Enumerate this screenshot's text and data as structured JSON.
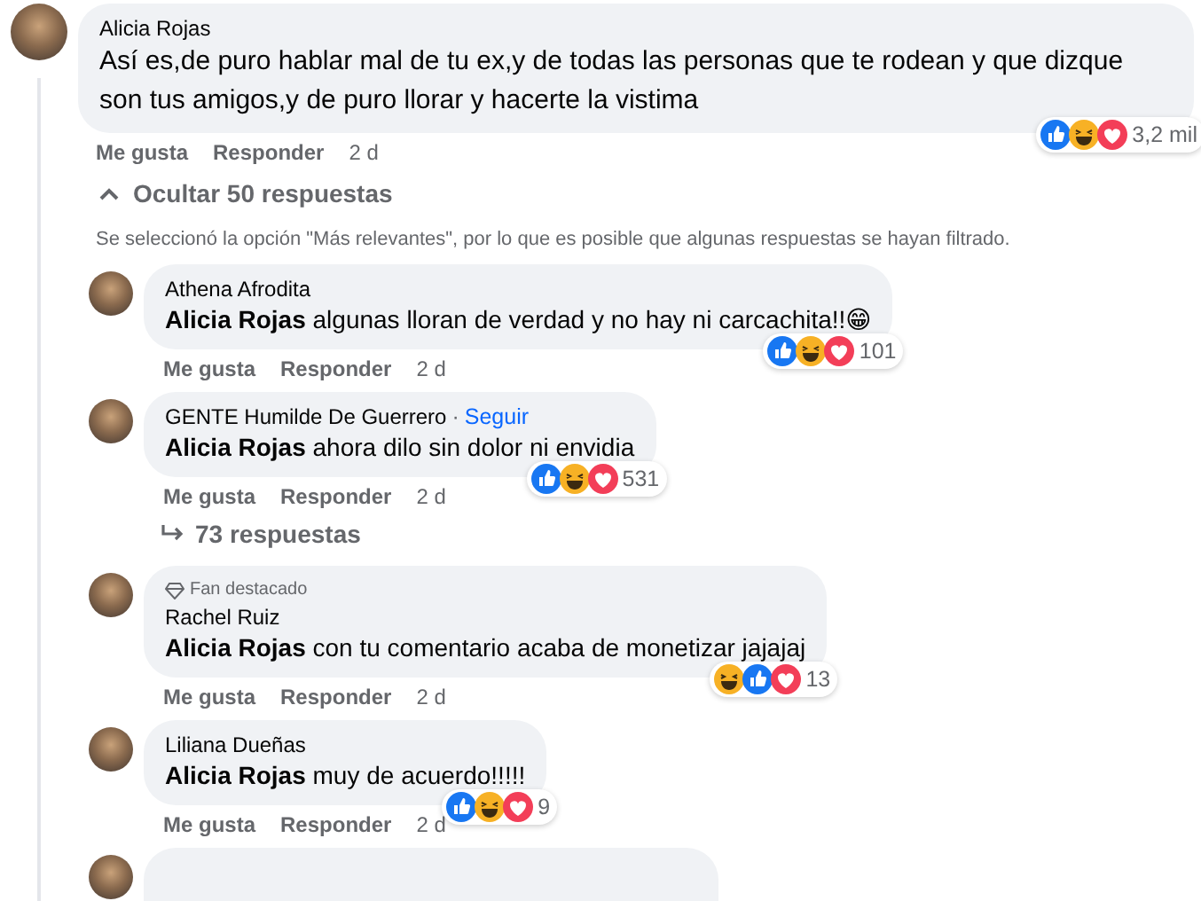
{
  "comment": {
    "author": "Alicia Rojas",
    "text": "Así es,de puro hablar mal de tu ex,y de todas las personas que te rodean y que dizque son tus amigos,y de puro llorar y hacerte la vistima",
    "reactions": [
      {
        "kind": "like"
      },
      {
        "kind": "haha"
      },
      {
        "kind": "love"
      }
    ],
    "reaction_count": "3,2 mil",
    "actions": {
      "like": "Me gusta",
      "reply": "Responder",
      "time": "2 d"
    }
  },
  "toggle_replies": "Ocultar 50 respuestas",
  "filter_notice": "Se seleccionó la opción \"Más relevantes\", por lo que es posible que algunas respuestas se hayan filtrado.",
  "replies": [
    {
      "author": "Athena Afrodita",
      "mention": "Alicia Rojas",
      "text": "algunas lloran de verdad y no hay ni carcachita!!😁",
      "reactions": [
        {
          "kind": "like"
        },
        {
          "kind": "haha"
        },
        {
          "kind": "love"
        }
      ],
      "reaction_count": "101",
      "actions": {
        "like": "Me gusta",
        "reply": "Responder",
        "time": "2 d"
      }
    },
    {
      "author": "GENTE Humilde De Guerrero",
      "separator": "·",
      "follow": "Seguir",
      "mention": "Alicia Rojas",
      "text": "ahora dilo sin dolor ni envidia",
      "reactions": [
        {
          "kind": "like"
        },
        {
          "kind": "haha"
        },
        {
          "kind": "love"
        }
      ],
      "reaction_count": "531",
      "actions": {
        "like": "Me gusta",
        "reply": "Responder",
        "time": "2 d"
      },
      "more_replies": "73 respuestas"
    },
    {
      "badge": "Fan destacado",
      "author": "Rachel Ruiz",
      "mention": "Alicia Rojas",
      "text": "con tu comentario acaba de monetizar jajajaj",
      "reactions": [
        {
          "kind": "haha"
        },
        {
          "kind": "like"
        },
        {
          "kind": "love"
        }
      ],
      "reaction_count": "13",
      "actions": {
        "like": "Me gusta",
        "reply": "Responder",
        "time": "2 d"
      }
    },
    {
      "author": "Liliana Dueñas",
      "mention": "Alicia Rojas",
      "text": "muy de acuerdo!!!!!",
      "reactions": [
        {
          "kind": "like"
        },
        {
          "kind": "haha"
        },
        {
          "kind": "love"
        }
      ],
      "reaction_count": "9",
      "actions": {
        "like": "Me gusta",
        "reply": "Responder",
        "time": "2 d"
      }
    }
  ]
}
